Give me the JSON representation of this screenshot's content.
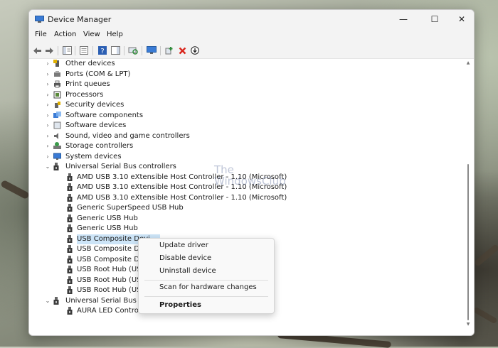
{
  "window": {
    "title": "Device Manager",
    "controls": {
      "minimize": "—",
      "maximize": "☐",
      "close": "✕"
    }
  },
  "menu": [
    "File",
    "Action",
    "View",
    "Help"
  ],
  "toolbar_icons": [
    "back-arrow-icon",
    "forward-arrow-icon",
    "show-hide-console-tree-icon",
    "properties-icon",
    "help-icon",
    "action-pane-icon",
    "scan-hardware-icon",
    "monitor-icon",
    "add-driver-icon",
    "uninstall-device-icon",
    "update-driver-icon"
  ],
  "tree": {
    "categories": [
      {
        "label": "Other devices",
        "icon": "other-devices-icon",
        "expander": "›"
      },
      {
        "label": "Ports (COM & LPT)",
        "icon": "ports-icon",
        "expander": "›"
      },
      {
        "label": "Print queues",
        "icon": "printer-icon",
        "expander": "›"
      },
      {
        "label": "Processors",
        "icon": "processor-icon",
        "expander": "›"
      },
      {
        "label": "Security devices",
        "icon": "security-icon",
        "expander": "›"
      },
      {
        "label": "Software components",
        "icon": "software-component-icon",
        "expander": "›"
      },
      {
        "label": "Software devices",
        "icon": "software-device-icon",
        "expander": "›"
      },
      {
        "label": "Sound, video and game controllers",
        "icon": "speaker-icon",
        "expander": "›"
      },
      {
        "label": "Storage controllers",
        "icon": "storage-icon",
        "expander": "›"
      },
      {
        "label": "System devices",
        "icon": "system-devices-icon",
        "expander": "›"
      }
    ],
    "usb_controllers": {
      "label": "Universal Serial Bus controllers",
      "expander": "⌄",
      "children": [
        "AMD USB 3.10 eXtensible Host Controller - 1.10 (Microsoft)",
        "AMD USB 3.10 eXtensible Host Controller - 1.10 (Microsoft)",
        "AMD USB 3.10 eXtensible Host Controller - 1.10 (Microsoft)",
        "Generic SuperSpeed USB Hub",
        "Generic USB Hub",
        "Generic USB Hub",
        "USB Composite Devi",
        "USB Composite Devi",
        "USB Composite Devi",
        "USB Root Hub (USB",
        "USB Root Hub (USB",
        "USB Root Hub (USB"
      ]
    },
    "usb_devices": {
      "label": "Universal Serial Bus devi",
      "expander": "⌄",
      "children": [
        "AURA LED Controlle"
      ]
    }
  },
  "context_menu": {
    "items": [
      "Update driver",
      "Disable device",
      "Uninstall device"
    ],
    "scan": "Scan for hardware changes",
    "properties": "Properties"
  },
  "watermark": {
    "line1": "The",
    "line2": "WindowsClub"
  },
  "colors": {
    "selection": "#cce4f7",
    "uninstall_red": "#d9261c",
    "add_green": "#2e8b3a"
  }
}
